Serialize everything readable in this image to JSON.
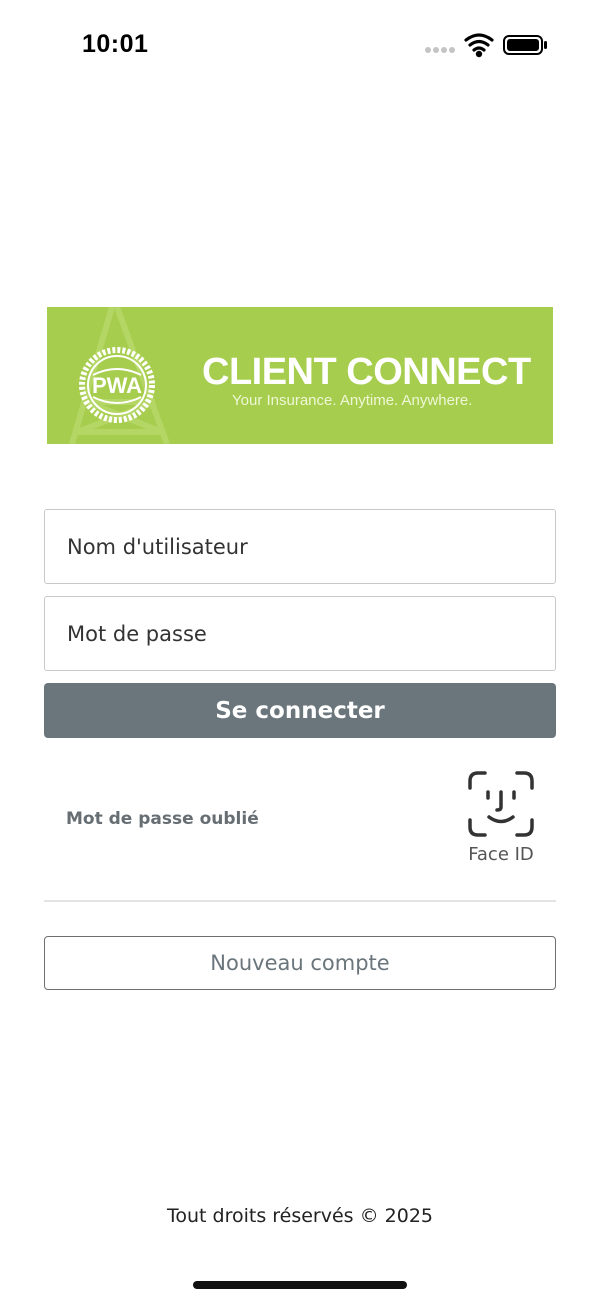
{
  "status_bar": {
    "time": "10:01"
  },
  "banner": {
    "seal_text": "PWA",
    "title": "CLIENT CONNECT",
    "tagline": "Your Insurance. Anytime. Anywhere.",
    "background_color": "#a6cd4d"
  },
  "form": {
    "username_placeholder": "Nom d'utilisateur",
    "username_value": "",
    "password_placeholder": "Mot de passe",
    "password_value": "",
    "login_label": "Se connecter",
    "forgot_password_label": "Mot de passe oublié",
    "face_id_label": "Face ID",
    "new_account_label": "Nouveau compte"
  },
  "footer": {
    "text": "Tout droits réservés © 2025"
  },
  "icons": {
    "signal": "cellular-signal-icon",
    "wifi": "wifi-icon",
    "battery": "battery-icon",
    "face_id": "face-id-icon"
  }
}
